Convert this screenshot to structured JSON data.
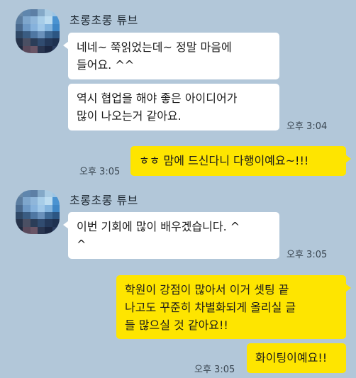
{
  "colors": {
    "background": "#b2c7d9",
    "incoming_bubble": "#ffffff",
    "outgoing_bubble": "#fee500"
  },
  "groups": [
    {
      "sender": "초롱초롱 튜브",
      "messages": [
        "네네~ 쭉읽었는데~ 정말 마음에\n들어요. ^^",
        "역시 협업을 해야 좋은 아이디어가\n많이 나오는거 같아요."
      ],
      "time": "오후 3:04"
    },
    {
      "messages": [
        "ㅎㅎ 맘에 드신다니 다행이예요~!!!"
      ],
      "time": "오후 3:05"
    },
    {
      "sender": "초롱초롱 튜브",
      "messages": [
        "이번 기회에 많이 배우겠습니다. ^\n^"
      ],
      "time": "오후 3:05"
    },
    {
      "messages": [
        "학원이 강점이 많아서 이거 셋팅 끝\n나고도 꾸준히 차별화되게 올리실 글\n들 많으실 것 같아요!!",
        "화이팅이예요!!"
      ],
      "time": "오후 3:05"
    }
  ]
}
